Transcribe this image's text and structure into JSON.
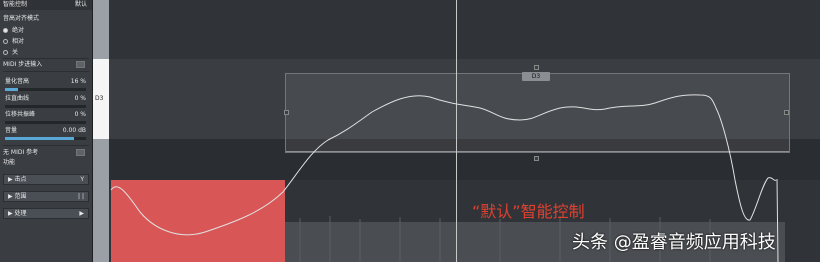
{
  "panel": {
    "header_label": "智能控制",
    "header_value": "默认",
    "align_mode_title": "音高对齐模式",
    "radios": [
      {
        "label": "绝对",
        "selected": true
      },
      {
        "label": "相对",
        "selected": false
      },
      {
        "label": "关",
        "selected": false
      }
    ],
    "midi_step_input": "MIDI 步进输入",
    "params": [
      {
        "label": "量化音高",
        "value": "16 %",
        "level": 0.16
      },
      {
        "label": "拉直曲线",
        "value": "0 %",
        "level": 0.0
      },
      {
        "label": "位移共振峰",
        "value": "0 %",
        "level": 0.0
      },
      {
        "label": "音量",
        "value": "0.00 dB",
        "level": 0.85
      }
    ],
    "midi_ref": "无 MIDI 参考",
    "function": "功能",
    "sections": [
      {
        "label": "▶ 击点",
        "icon": "funnel-icon",
        "glyph": "Y"
      },
      {
        "label": "▶ 范围",
        "icon": "range-icon",
        "glyph": "| |"
      },
      {
        "label": "▶ 处理",
        "icon": "play-circle-icon",
        "glyph": "▶"
      }
    ]
  },
  "editor": {
    "note_name": "D3",
    "selection_tag": "D3"
  },
  "colors": {
    "accent": "#5aa8d8",
    "note_red": "#d95656",
    "caption_red": "#e0412f"
  },
  "caption": "“默认”智能控制",
  "watermark": "头条 @盈睿音频应用科技"
}
